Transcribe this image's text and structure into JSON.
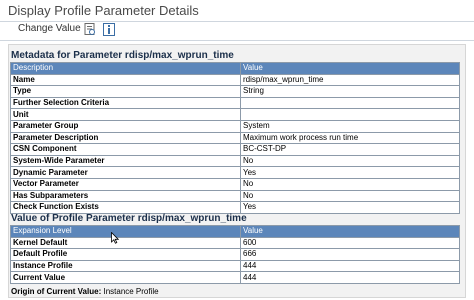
{
  "window": {
    "title": "Display Profile Parameter Details"
  },
  "toolbar": {
    "change_value_label": "Change Value"
  },
  "metadata": {
    "title": "Metadata for Parameter rdisp/max_wprun_time",
    "columns": [
      "Description",
      "Value"
    ],
    "rows": [
      {
        "label": "Name",
        "value": "rdisp/max_wprun_time"
      },
      {
        "label": "Type",
        "value": "String"
      },
      {
        "label": "Further Selection Criteria",
        "value": ""
      },
      {
        "label": "Unit",
        "value": ""
      },
      {
        "label": "Parameter Group",
        "value": "System"
      },
      {
        "label": "Parameter Description",
        "value": "Maximum work process run time"
      },
      {
        "label": "CSN Component",
        "value": "BC-CST-DP"
      },
      {
        "label": "System-Wide Parameter",
        "value": "No"
      },
      {
        "label": "Dynamic Parameter",
        "value": "Yes"
      },
      {
        "label": "Vector Parameter",
        "value": "No"
      },
      {
        "label": "Has Subparameters",
        "value": "No"
      },
      {
        "label": "Check Function Exists",
        "value": "Yes"
      }
    ]
  },
  "profile_values": {
    "title": "Value of Profile Parameter rdisp/max_wprun_time",
    "columns": [
      "Expansion Level",
      "Value"
    ],
    "rows": [
      {
        "label": "Kernel Default",
        "value": "600"
      },
      {
        "label": "Default Profile",
        "value": "666"
      },
      {
        "label": "Instance Profile",
        "value": "444"
      },
      {
        "label": "Current Value",
        "value": "444"
      }
    ]
  },
  "origin": {
    "label": "Origin of Current Value:",
    "value": "Instance Profile"
  }
}
